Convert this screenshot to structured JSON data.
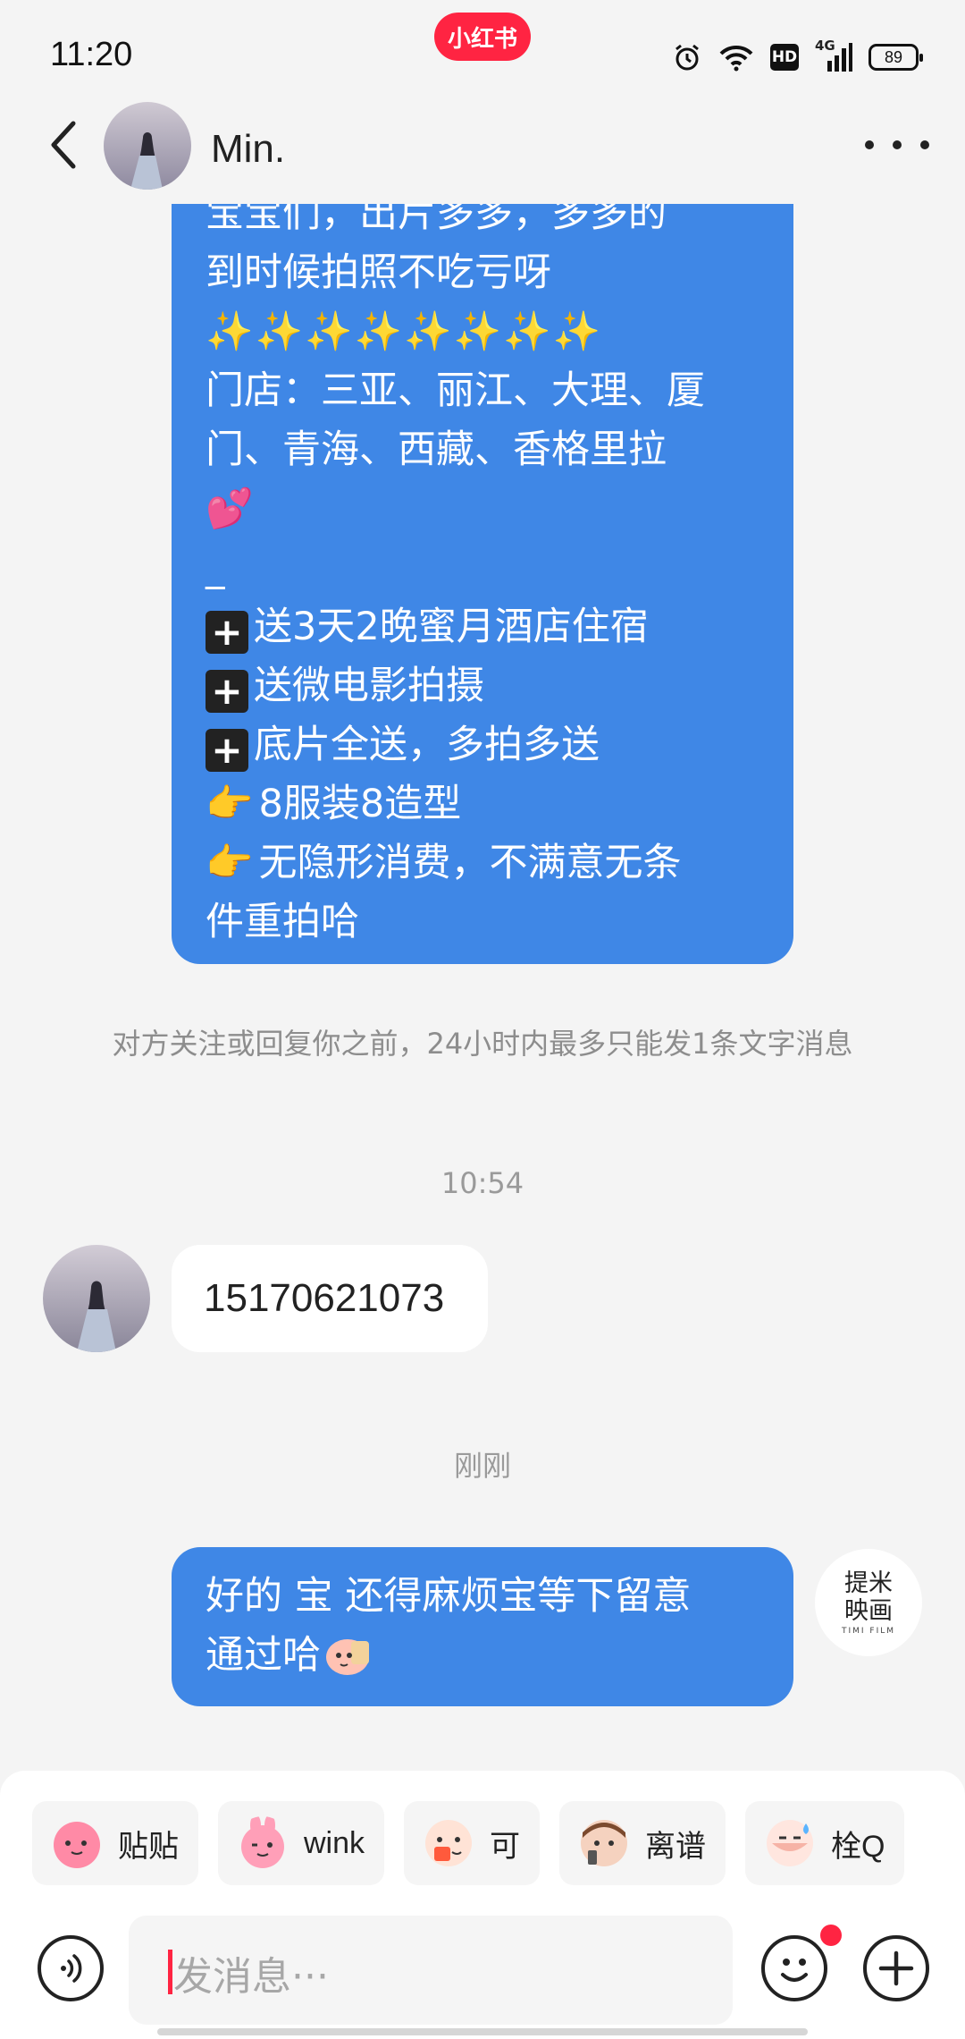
{
  "status_bar": {
    "time": "11:20",
    "app_badge": "小红书",
    "icons": [
      "alarm-icon",
      "wifi-icon",
      "hd-icon",
      "signal-4g-icon",
      "battery-icon"
    ],
    "hd_label": "HD",
    "network_label": "4G",
    "battery": "89"
  },
  "header": {
    "contact_name": "Min."
  },
  "messages": {
    "promo_lines": [
      "到时候拍照不吃亏呀",
      "✨✨✨✨✨✨✨✨",
      "门店：三亚、丽江、大理、厦",
      "门、青海、西藏、香格里拉",
      "💕",
      "_",
      "送3天2晚蜜月酒店住宿",
      "送微电影拍摄",
      "底片全送，多拍多送",
      "8服装8造型",
      "无隐形消费，不满意无条",
      "件重拍哈"
    ],
    "plus_symbol": "+",
    "hand_symbol": "👉",
    "system_note": "对方关注或回复你之前，24小时内最多只能发1条文字消息",
    "time_1": "10:54",
    "incoming_text": "15170621073",
    "time_2": "刚刚",
    "reply_line_1": "好的  宝 还得麻烦宝等下留意",
    "reply_line_2": "通过哈",
    "shop_logo_line_1": "提米",
    "shop_logo_line_2": "映画",
    "shop_logo_sub": "TIMI FILM"
  },
  "stickers": [
    {
      "label": "贴贴",
      "color": "#ff8aa6"
    },
    {
      "label": "wink",
      "color": "#ff9fb8"
    },
    {
      "label": "可",
      "color": "#ffc6b0"
    },
    {
      "label": "离谱",
      "color": "#c79370"
    },
    {
      "label": "栓Q",
      "color": "#f6b3a6"
    }
  ],
  "input": {
    "placeholder": "发消息···"
  },
  "colors": {
    "accent": "#ff2442",
    "my_bubble": "#3f87e6",
    "background": "#f4f4f4"
  }
}
